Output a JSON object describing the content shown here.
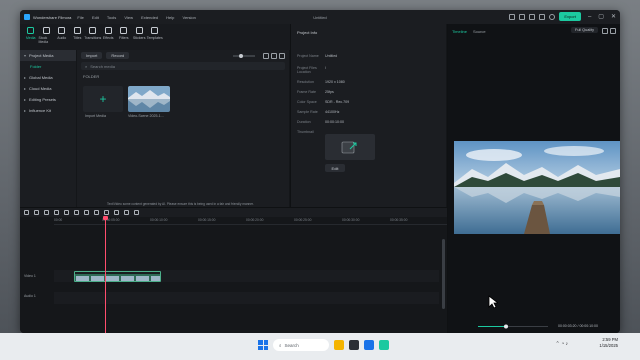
{
  "window": {
    "app_name": "Wondershare Filmora",
    "menu": [
      "File",
      "Edit",
      "Tools",
      "View",
      "Extended",
      "Help",
      "Version"
    ],
    "doc_title": "Untitled",
    "export_label": "Export"
  },
  "toolbar": {
    "items": [
      {
        "label": "Media",
        "icon": "media-icon"
      },
      {
        "label": "Stock Media",
        "icon": "stock-icon"
      },
      {
        "label": "Audio",
        "icon": "audio-icon"
      },
      {
        "label": "Titles",
        "icon": "titles-icon"
      },
      {
        "label": "Transitions",
        "icon": "transitions-icon"
      },
      {
        "label": "Effects",
        "icon": "effects-icon"
      },
      {
        "label": "Filters",
        "icon": "filters-icon"
      },
      {
        "label": "Stickers",
        "icon": "stickers-icon"
      },
      {
        "label": "Templates",
        "icon": "templates-icon"
      }
    ]
  },
  "sidebar": {
    "items": [
      {
        "label": "Project Media"
      },
      {
        "label": "Folder"
      },
      {
        "label": "Global Media"
      },
      {
        "label": "Cloud Media"
      },
      {
        "label": "Editing Presets"
      },
      {
        "label": "Influence Kit"
      }
    ]
  },
  "media": {
    "import_label": "Import",
    "record_label": "Record",
    "search_placeholder": "Search media",
    "folder_label": "FOLDER",
    "import_tile_label": "Import Media",
    "clip_label": "Video-Scene 2025-1...",
    "note": "Text/Video some content generated by AI. Please ensure this is being used in a fair and friendly manner."
  },
  "project_info": {
    "title": "Project Info",
    "rows": [
      {
        "k": "Project Name",
        "v": "Untitled"
      },
      {
        "k": "Project Files Location",
        "v": "/"
      },
      {
        "k": "Resolution",
        "v": "1920 x 1080"
      },
      {
        "k": "Frame Rate",
        "v": "25fps"
      },
      {
        "k": "Color Space",
        "v": "SDR - Rec.709"
      },
      {
        "k": "Sample Rate",
        "v": "44100Hz"
      },
      {
        "k": "Duration",
        "v": "00:00:10:00"
      },
      {
        "k": "Thumbnail",
        "v": ""
      }
    ],
    "edit_label": "Edit"
  },
  "player": {
    "tabs": [
      "Timeline",
      "Source"
    ],
    "quality": "Full Quality",
    "current_time": "00:00:03:20",
    "total_time": "00:00:10:00"
  },
  "timeline": {
    "ruler": [
      "00:00",
      "00:00:05:00",
      "00:00:10:00",
      "00:00:15:00",
      "00:00:20:00",
      "00:00:25:00",
      "00:00:30:00",
      "00:00:35:00"
    ],
    "tracks": [
      {
        "label": "Video 1"
      },
      {
        "label": "Audio 1"
      }
    ]
  },
  "taskbar": {
    "search": "Search",
    "time": "2:59 PM",
    "date": "1/15/2025"
  }
}
